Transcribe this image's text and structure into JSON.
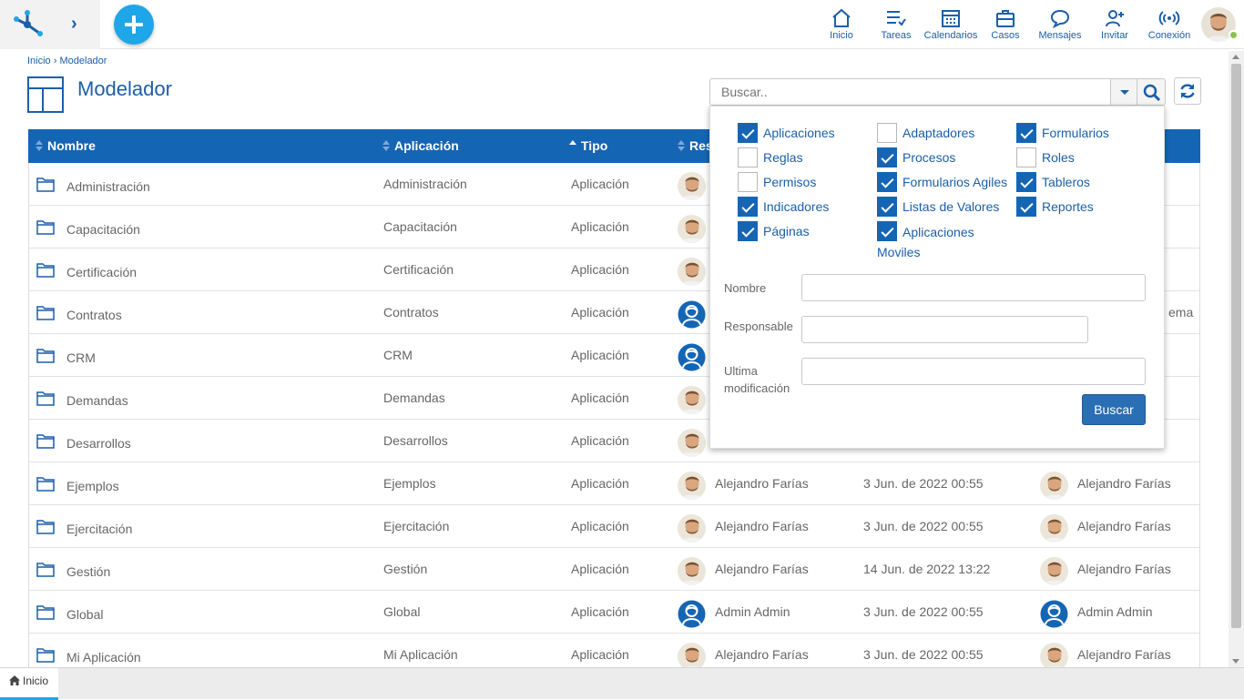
{
  "topbar": {
    "nav": [
      {
        "label": "Inicio",
        "icon": "home-icon"
      },
      {
        "label": "Tareas",
        "icon": "tasks-icon"
      },
      {
        "label": "Calendarios",
        "icon": "calendar-icon"
      },
      {
        "label": "Casos",
        "icon": "briefcase-icon"
      },
      {
        "label": "Mensajes",
        "icon": "chat-icon"
      },
      {
        "label": "Invitar",
        "icon": "add-user-icon"
      },
      {
        "label": "Conexión",
        "icon": "signal-icon"
      }
    ],
    "accent": "#1fa6e8"
  },
  "breadcrumb": {
    "home": "Inicio",
    "separator": "›",
    "current": "Modelador"
  },
  "page": {
    "title": "Modelador"
  },
  "search": {
    "placeholder": "Buscar.."
  },
  "table": {
    "header_color": "#1565b5",
    "columns": [
      "Nombre",
      "Aplicación",
      "Tipo",
      "Res"
    ],
    "rows": [
      {
        "name": "Administración",
        "app": "Administración",
        "type": "Aplicación",
        "avatar": "photo",
        "responsible": "",
        "date": "",
        "modifier": "",
        "tail": "",
        "mod_avatar": false
      },
      {
        "name": "Capacitación",
        "app": "Capacitación",
        "type": "Aplicación",
        "avatar": "photo",
        "responsible": "",
        "date": "",
        "modifier": "",
        "tail": "",
        "mod_avatar": false
      },
      {
        "name": "Certificación",
        "app": "Certificación",
        "type": "Aplicación",
        "avatar": "photo",
        "responsible": "",
        "date": "",
        "modifier": "",
        "tail": "",
        "mod_avatar": false
      },
      {
        "name": "Contratos",
        "app": "Contratos",
        "type": "Aplicación",
        "avatar": "admin",
        "responsible": "",
        "date": "",
        "modifier": "",
        "tail": "ema",
        "mod_avatar": false
      },
      {
        "name": "CRM",
        "app": "CRM",
        "type": "Aplicación",
        "avatar": "admin",
        "responsible": "",
        "date": "",
        "modifier": "",
        "tail": "",
        "mod_avatar": false
      },
      {
        "name": "Demandas",
        "app": "Demandas",
        "type": "Aplicación",
        "avatar": "photo",
        "responsible": "",
        "date": "",
        "modifier": "",
        "tail": "",
        "mod_avatar": false
      },
      {
        "name": "Desarrollos",
        "app": "Desarrollos",
        "type": "Aplicación",
        "avatar": "photo",
        "responsible": "",
        "date": "",
        "modifier": "",
        "tail": "",
        "mod_avatar": false
      },
      {
        "name": "Ejemplos",
        "app": "Ejemplos",
        "type": "Aplicación",
        "avatar": "photo",
        "responsible": "Alejandro Farías",
        "date": "3 Jun. de 2022 00:55",
        "modifier": "Alejandro Farías",
        "tail": "",
        "mod_avatar": "photo"
      },
      {
        "name": "Ejercitación",
        "app": "Ejercitación",
        "type": "Aplicación",
        "avatar": "photo",
        "responsible": "Alejandro Farías",
        "date": "3 Jun. de 2022 00:55",
        "modifier": "Alejandro Farías",
        "tail": "",
        "mod_avatar": "photo"
      },
      {
        "name": "Gestión",
        "app": "Gestión",
        "type": "Aplicación",
        "avatar": "photo",
        "responsible": "Alejandro Farías",
        "date": "14 Jun. de 2022 13:22",
        "modifier": "Alejandro Farías",
        "tail": "",
        "mod_avatar": "photo"
      },
      {
        "name": "Global",
        "app": "Global",
        "type": "Aplicación",
        "avatar": "admin",
        "responsible": "Admin Admin",
        "date": "3 Jun. de 2022 00:55",
        "modifier": "Admin Admin",
        "tail": "",
        "mod_avatar": "admin"
      },
      {
        "name": "Mi Aplicación",
        "app": "Mi Aplicación",
        "type": "Aplicación",
        "avatar": "photo",
        "responsible": "Alejandro Farías",
        "date": "3 Jun. de 2022 00:55",
        "modifier": "Alejandro Farías",
        "tail": "",
        "mod_avatar": "photo"
      }
    ]
  },
  "filter": {
    "checkboxes": [
      {
        "label": "Aplicaciones",
        "checked": true
      },
      {
        "label": "Adaptadores",
        "checked": false
      },
      {
        "label": "Formularios",
        "checked": true
      },
      {
        "label": "Reglas",
        "checked": false
      },
      {
        "label": "Procesos",
        "checked": true
      },
      {
        "label": "Roles",
        "checked": false
      },
      {
        "label": "Permisos",
        "checked": false
      },
      {
        "label": "Formularios Agiles",
        "checked": true
      },
      {
        "label": "Tableros",
        "checked": true
      },
      {
        "label": "Indicadores",
        "checked": true
      },
      {
        "label": "Listas de Valores",
        "checked": true
      },
      {
        "label": "Reportes",
        "checked": true
      },
      {
        "label": "Páginas",
        "checked": true
      },
      {
        "label": "Aplicaciones Moviles",
        "checked": true
      }
    ],
    "fields": {
      "nombre_label": "Nombre",
      "responsable_label": "Responsable",
      "ultima_label": "Ultima modificación"
    },
    "submit": "Buscar"
  },
  "bottom_tabs": [
    {
      "label": "Inicio",
      "icon": "home-icon"
    }
  ]
}
